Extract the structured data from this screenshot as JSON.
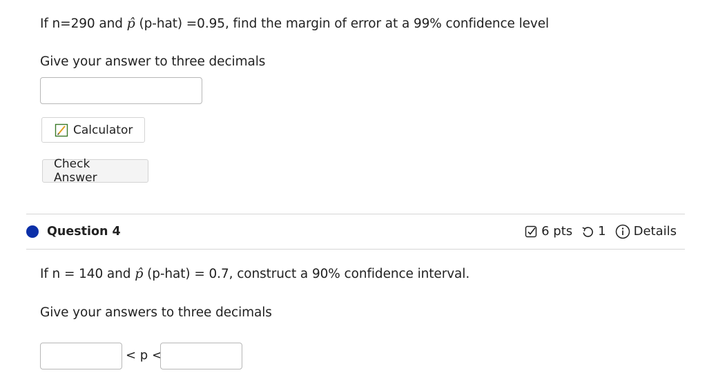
{
  "question3": {
    "text_prefix": "If n=290 and",
    "phat_symbol": "p̂",
    "text_suffix": "(p-hat) =0.95, find the margin of error at a 99% confidence level",
    "instruction": "Give your answer to three decimals",
    "answer_value": "",
    "calculator_label": "Calculator",
    "check_answer_label": "Check Answer"
  },
  "question4": {
    "title": "Question 4",
    "points": "6 pts",
    "retries": "1",
    "details_label": "Details",
    "text_prefix": "If n = 140 and",
    "phat_symbol": "p̂",
    "text_suffix": "(p-hat) = 0.7, construct a 90% confidence interval.",
    "instruction": "Give your answers to three decimals",
    "inequality_middle": "< p <",
    "lower_value": "",
    "upper_value": ""
  },
  "colors": {
    "question_dot": "#0b2fa8",
    "calculator_icon_border": "#3a7a28",
    "calculator_icon_pen": "#e0a020"
  },
  "icons": {
    "calculator": "calculator-icon",
    "points": "checkbox-icon",
    "retries": "retry-icon",
    "details": "info-icon"
  }
}
